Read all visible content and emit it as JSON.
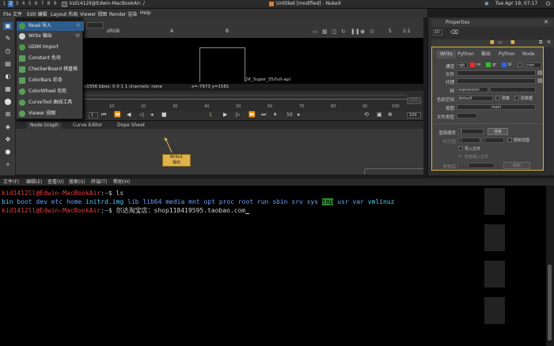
{
  "sysbar": {
    "workspaces": [
      "1",
      "2",
      "3",
      "4",
      "5",
      "6",
      "7",
      "8",
      "9"
    ],
    "window_label": "kid1412ll@Edwin-MacBookAir: /",
    "app_title": "Untitled [modified] - NukeX",
    "clock": "Tue Apr 19, 07:17"
  },
  "nuke_menu": [
    "File 文件",
    "Edit 编辑",
    "Layout 布局",
    "Viewer 视图",
    "Render 渲染",
    "Help"
  ],
  "dropdown": {
    "items": [
      {
        "label": "Read 导入",
        "shortcut": "R",
        "color": "#4a9a4a"
      },
      {
        "label": "Write 输出",
        "shortcut": "W",
        "color": "#cfcfcf"
      },
      {
        "label": "UDIM Import",
        "shortcut": "",
        "color": "#4a9a4a"
      },
      {
        "label": "Constant 色块",
        "shortcut": "",
        "color": "#5aa05a"
      },
      {
        "label": "CheckerBoard 棋盘格",
        "shortcut": "",
        "color": "#5aa05a"
      },
      {
        "label": "ColorBars 彩条",
        "shortcut": "",
        "color": "#5aa05a"
      },
      {
        "label": "ColorWheel 色轮",
        "shortcut": "",
        "color": "#5aa05a"
      },
      {
        "label": "CurveTool 曲线工具",
        "shortcut": "",
        "color": "#5aa05a"
      },
      {
        "label": "Viewer 视图",
        "shortcut": "",
        "color": "#5aa05a"
      }
    ]
  },
  "viewer": {
    "colorspace": "sRGB",
    "channel": "A",
    "channel_b": "B",
    "y_label": "Y",
    "y_value": "1",
    "zoom": "1:1",
    "fps_label": "5",
    "format_label": "2K_Super_35(full-ap)",
    "status_left": "x1556  bbox: 0 0 1 1 channels: none",
    "status_right": "x=-7973 y=1581"
  },
  "timeline": {
    "ticks": [
      "10",
      "20",
      "30",
      "40",
      "50",
      "60",
      "70",
      "80",
      "90",
      "100"
    ],
    "start": "1",
    "end": "100",
    "current": "1",
    "step": "10",
    "right_field": "100"
  },
  "tabs": [
    "Node Graph",
    "Curve Editor",
    "Dope Sheet"
  ],
  "write_node": {
    "title": "Write1",
    "subtitle": "输出"
  },
  "properties": {
    "title": "Properties",
    "count": "10",
    "node_tabs": [
      "Write",
      "Python",
      "输出",
      "Python",
      "Node"
    ],
    "channels_label": "通道",
    "channels_value": "rgb",
    "ch_r": "re",
    "ch_g": "gr",
    "ch_b": "bl",
    "ch_none": "non",
    "file_label": "文件",
    "proxy_label": "代理",
    "frame_label": "帧",
    "frame_value": "expression",
    "colorspace_label": "色彩空间",
    "colorspace_value": "default",
    "premult_label": "预乘",
    "raw_label": "原数据",
    "view_label": "视图",
    "view_value": "main",
    "filetype_label": "文件类型",
    "render_order_label": "渲染顺序",
    "render_order_value": "1",
    "render_button": "渲染",
    "frame_range_label": "帧范围",
    "range_start": "1",
    "range_end": "1",
    "limit_label": "限制范围",
    "read_file_label": "导入文件",
    "check_file_label": "检查输入文件",
    "error_label": "失败后",
    "error_value": "error",
    "reload_label": "刷新"
  },
  "terminal": {
    "menu": [
      "文件(F)",
      "编辑(E)",
      "查看(V)",
      "搜索(S)",
      "终端(T)",
      "帮助(H)"
    ],
    "prompt_user": "kid1412ll@Edwin-MacBookAir",
    "prompt_path": "~",
    "cmd1": "ls",
    "ls": [
      {
        "name": "bin",
        "type": "cyan"
      },
      {
        "name": "boot",
        "type": "blue"
      },
      {
        "name": "dev",
        "type": "blue"
      },
      {
        "name": "etc",
        "type": "blue"
      },
      {
        "name": "home",
        "type": "blue"
      },
      {
        "name": "initrd.img",
        "type": "cyan"
      },
      {
        "name": "lib",
        "type": "blue"
      },
      {
        "name": "lib64",
        "type": "blue"
      },
      {
        "name": "media",
        "type": "blue"
      },
      {
        "name": "mnt",
        "type": "blue"
      },
      {
        "name": "opt",
        "type": "blue"
      },
      {
        "name": "proc",
        "type": "blue"
      },
      {
        "name": "root",
        "type": "blue"
      },
      {
        "name": "run",
        "type": "blue"
      },
      {
        "name": "sbin",
        "type": "blue"
      },
      {
        "name": "srv",
        "type": "blue"
      },
      {
        "name": "sys",
        "type": "blue"
      },
      {
        "name": "tmp",
        "type": "hl"
      },
      {
        "name": "usr",
        "type": "blue"
      },
      {
        "name": "var",
        "type": "blue"
      },
      {
        "name": "vmlinuz",
        "type": "cyan"
      }
    ],
    "cmd2": "尔达淘宝店：shop118419595.taobao.com"
  }
}
